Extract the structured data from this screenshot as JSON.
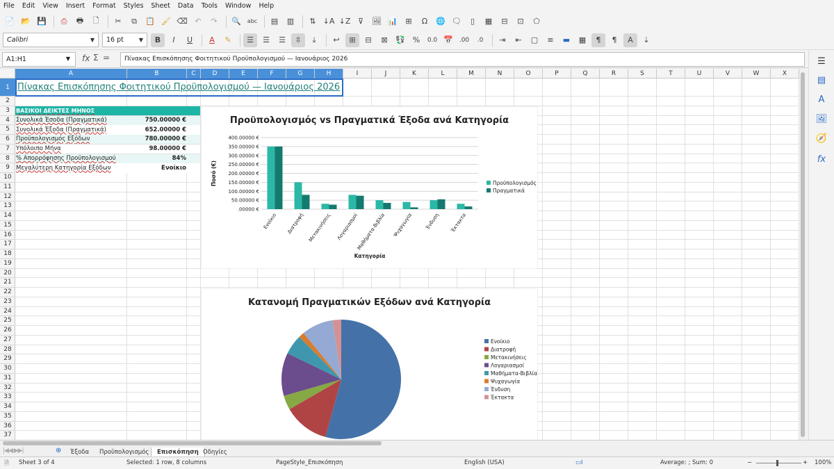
{
  "menu": [
    "File",
    "Edit",
    "View",
    "Insert",
    "Format",
    "Styles",
    "Sheet",
    "Data",
    "Tools",
    "Window",
    "Help"
  ],
  "font": {
    "name": "Calibri",
    "size": "16 pt"
  },
  "namebox": "A1:H1",
  "formula": "Πίνακας Επισκόπησης Φοιτητικού Προϋπολογισμού — Ιανουάριος 2026",
  "columns": [
    {
      "label": "A",
      "w": 161
    },
    {
      "label": "B",
      "w": 86
    },
    {
      "label": "C",
      "w": 20
    },
    {
      "label": "D",
      "w": 41
    },
    {
      "label": "E",
      "w": 41
    },
    {
      "label": "F",
      "w": 41
    },
    {
      "label": "G",
      "w": 41
    },
    {
      "label": "H",
      "w": 41
    },
    {
      "label": "I",
      "w": 41
    },
    {
      "label": "J",
      "w": 41
    },
    {
      "label": "K",
      "w": 41
    },
    {
      "label": "L",
      "w": 41
    },
    {
      "label": "M",
      "w": 41
    },
    {
      "label": "N",
      "w": 41
    },
    {
      "label": "O",
      "w": 41
    },
    {
      "label": "P",
      "w": 41
    },
    {
      "label": "Q",
      "w": 41
    },
    {
      "label": "R",
      "w": 41
    },
    {
      "label": "S",
      "w": 41
    },
    {
      "label": "T",
      "w": 41
    },
    {
      "label": "U",
      "w": 41
    },
    {
      "label": "V",
      "w": 41
    },
    {
      "label": "W",
      "w": 41
    },
    {
      "label": "X",
      "w": 41
    }
  ],
  "sheet": {
    "title": "Πίνακας Επισκόπησης Φοιτητικού Προϋπολογισμού — Ιανουάριος 2026",
    "kpi_header": "ΒΑΣΙΚΟΙ ΔΕΙΚΤΕΣ ΜΗΝΟΣ",
    "kpis": [
      {
        "label": "Συνολικά Έσοδα (Πραγματικά)",
        "value": "750.00000 €"
      },
      {
        "label": "Συνολικά Έξοδα (Πραγματικά)",
        "value": "652.00000 €"
      },
      {
        "label": "Προϋπολογισμός Εξόδων",
        "value": "780.00000 €"
      },
      {
        "label": "Υπόλοιπο Μήνα",
        "value": "98.00000 €"
      },
      {
        "label": "% Απορρόφησης Προϋπολογισμού",
        "value": "84%"
      },
      {
        "label": "Μεγαλύτερη Κατηγορία Εξόδων",
        "value": "Ενοίκιο"
      }
    ]
  },
  "chart_data": [
    {
      "type": "bar",
      "title": "Προϋπολογισμός vs Πραγματικά Έξοδα ανά Κατηγορία",
      "xlabel": "Κατηγορία",
      "ylabel": "Ποσό (€)",
      "ylim": [
        0,
        400
      ],
      "yticks": [
        "400.00000 €",
        "350.00000 €",
        "300.00000 €",
        "250.00000 €",
        "200.00000 €",
        "150.00000 €",
        "100.00000 €",
        "50.00000 €",
        ".00000 €"
      ],
      "categories": [
        "Ενοίκιο",
        "Διατροφή",
        "Μετακινήσεις",
        "Λογαριασμοί",
        "Μαθήματα-Βιβλία",
        "Ψυχαγωγία",
        "Ένδυση",
        "Έκτακτα"
      ],
      "series": [
        {
          "name": "Προϋπολογισμός",
          "color": "#2bb8a6",
          "values": [
            350,
            150,
            30,
            80,
            50,
            40,
            50,
            30
          ]
        },
        {
          "name": "Πραγματικά",
          "color": "#147a6f",
          "values": [
            350,
            80,
            25,
            75,
            35,
            10,
            55,
            15
          ]
        }
      ],
      "legend": "right"
    },
    {
      "type": "pie",
      "title": "Κατανομή Πραγματικών Εξόδων ανά Κατηγορία",
      "categories": [
        "Ενοίκιο",
        "Διατροφή",
        "Μετακινήσεις",
        "Λογαριασμοί",
        "Μαθήματα-Βιβλία",
        "Ψυχαγωγία",
        "Ένδυση",
        "Έκτακτα"
      ],
      "values": [
        350,
        80,
        25,
        75,
        35,
        10,
        55,
        15
      ],
      "colors": [
        "#4472a8",
        "#b04444",
        "#86a845",
        "#6b4c8c",
        "#3f97ad",
        "#d97c30",
        "#94aad4",
        "#d49194"
      ],
      "legend": "right"
    }
  ],
  "tabs": [
    "Έξοδα",
    "Προϋπολογισμός",
    "Επισκόπηση",
    "Οδηγίες"
  ],
  "active_tab": "Επισκόπηση",
  "status": {
    "sheet": "Sheet 3 of 4",
    "selection": "Selected: 1 row, 8 columns",
    "pagestyle": "PageStyle_Επισκόπηση",
    "language": "English (USA)",
    "summary": "Average: ; Sum: 0",
    "zoom": "100%"
  }
}
